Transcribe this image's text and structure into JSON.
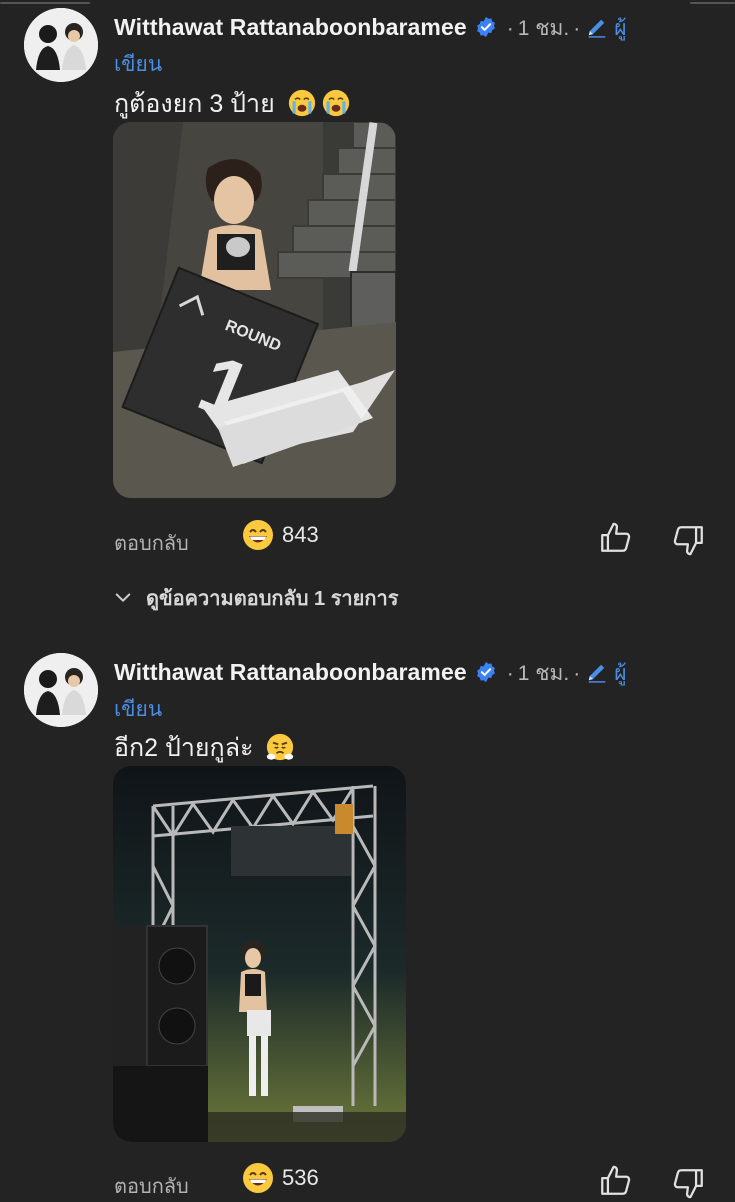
{
  "comments": [
    {
      "author": "Witthawat Rattanaboonbaramee",
      "time": "1 ชม.",
      "badge_part1": "ผู้",
      "badge_part2": "เขียน",
      "text": "กูต้องยก 3 ป้าย",
      "emoji": [
        "crying-face",
        "crying-face"
      ],
      "photo_text": "ROUND",
      "photo_number": "1",
      "reply_label": "ตอบกลับ",
      "reaction_count": "843"
    },
    {
      "author": "Witthawat Rattanaboonbaramee",
      "time": "1 ชม.",
      "badge_part1": "ผู้",
      "badge_part2": "เขียน",
      "text": "อีก2 ป้ายกูล่ะ",
      "emoji": [
        "steam-face"
      ],
      "reply_label": "ตอบกลับ",
      "reaction_count": "536"
    }
  ],
  "view_replies": "ดูข้อความตอบกลับ 1 รายการ",
  "colors": {
    "background": "#232323",
    "accent": "#4a8fe7",
    "verified": "#3b82f6",
    "muted": "#b3b3b3"
  }
}
